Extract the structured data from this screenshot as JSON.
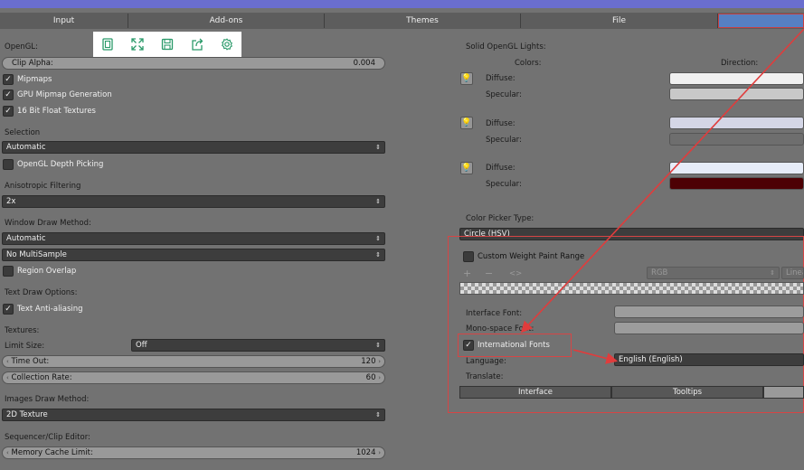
{
  "colors": {
    "accent": "#5680c2",
    "highlight": "#d64545"
  },
  "tabs": [
    "Input",
    "Add-ons",
    "Themes",
    "File",
    ""
  ],
  "toolbar_icons": [
    "fullscreen-icon",
    "expand-icon",
    "save-icon",
    "share-icon",
    "settings-icon"
  ],
  "left": {
    "opengl_label": "OpenGL:",
    "clip_alpha_label": "Clip Alpha:",
    "clip_alpha_value": "0.004",
    "mipmaps": "Mipmaps",
    "gpu_mipmap": "GPU Mipmap Generation",
    "float_textures": "16 Bit Float Textures",
    "selection_label": "Selection",
    "selection_value": "Automatic",
    "depth_picking": "OpenGL Depth Picking",
    "aniso_label": "Anisotropic Filtering",
    "aniso_value": "2x",
    "window_draw_label": "Window Draw Method:",
    "window_draw_value": "Automatic",
    "multisample_value": "No MultiSample",
    "region_overlap": "Region Overlap",
    "text_draw_label": "Text Draw Options:",
    "text_aa": "Text Anti-aliasing",
    "textures_label": "Textures:",
    "limit_size_label": "Limit Size:",
    "limit_size_value": "Off",
    "timeout_label": "Time Out:",
    "timeout_value": "120",
    "collection_label": "Collection Rate:",
    "collection_value": "60",
    "images_draw_label": "Images Draw Method:",
    "images_draw_value": "2D Texture",
    "sequencer_label": "Sequencer/Clip Editor:",
    "memcache_label": "Memory Cache Limit:",
    "memcache_value": "1024"
  },
  "right": {
    "lights_label": "Solid OpenGL Lights:",
    "colors_label": "Colors:",
    "direction_label": "Direction:",
    "diffuse": "Diffuse:",
    "specular": "Specular:",
    "picker_label": "Color Picker Type:",
    "picker_value": "Circle (HSV)",
    "custom_weight": "Custom Weight Paint Range",
    "plus": "+",
    "minus": "−",
    "arrows": "<>",
    "rgb": "RGB",
    "linear": "Linea",
    "interface_font": "Interface Font:",
    "mono_font": "Mono-space Font:",
    "intl_fonts": "International Fonts",
    "language_label": "Language:",
    "language_value": "English (English)",
    "translate_label": "Translate:",
    "translate_interface": "Interface",
    "translate_tooltips": "Tooltips"
  }
}
